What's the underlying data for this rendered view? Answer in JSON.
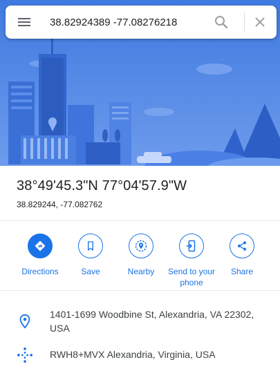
{
  "search": {
    "value": "38.82924389 -77.08276218",
    "menu_icon": "hamburger-menu-icon",
    "search_icon": "magnifier-icon",
    "close_icon": "close-x-icon"
  },
  "place": {
    "title": "38°49'45.3\"N 77°04'57.9\"W",
    "decimal": "38.829244, -77.082762"
  },
  "actions": [
    {
      "label": "Directions",
      "icon": "directions-icon"
    },
    {
      "label": "Save",
      "icon": "bookmark-icon"
    },
    {
      "label": "Nearby",
      "icon": "nearby-icon"
    },
    {
      "label": "Send to your phone",
      "icon": "send-to-phone-icon"
    },
    {
      "label": "Share",
      "icon": "share-icon"
    }
  ],
  "details": {
    "address": "1401-1699 Woodbine St, Alexandria, VA 22302, USA",
    "plus_code": "RWH8+MVX Alexandria, Virginia, USA"
  },
  "colors": {
    "accent": "#1a73e8",
    "hero_sky": "#5b8ee6",
    "text": "#202124"
  }
}
